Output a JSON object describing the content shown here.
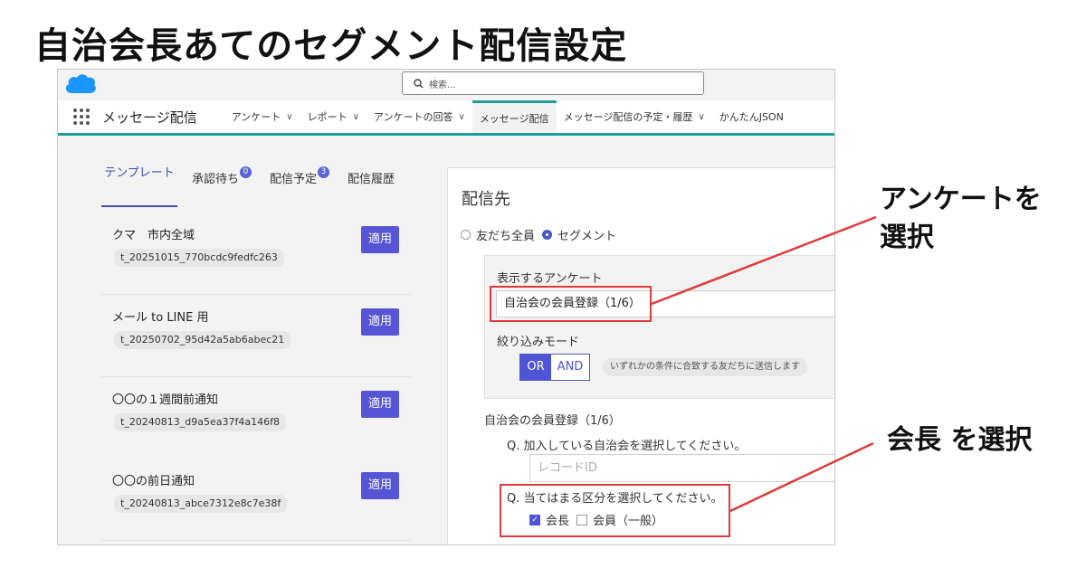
{
  "headline": "自治会長あてのセグメント配信設定",
  "search": {
    "placeholder": "検索..."
  },
  "nav": {
    "app_name": "メッセージ配信",
    "items": [
      {
        "label": "アンケート",
        "has_menu": true
      },
      {
        "label": "レポート",
        "has_menu": true
      },
      {
        "label": "アンケートの回答",
        "has_menu": true
      },
      {
        "label": "メッセージ配信",
        "has_menu": false,
        "active": true
      },
      {
        "label": "メッセージ配信の予定・履歴",
        "has_menu": true
      },
      {
        "label": "かんたんJSON",
        "has_menu": false
      }
    ]
  },
  "tabs": {
    "template": "テンプレート",
    "approval": "承認待ち",
    "approval_count": "0",
    "scheduled": "配信予定",
    "scheduled_count": "3",
    "history": "配信履歴"
  },
  "templates": [
    {
      "name": "クマ　市内全域",
      "id": "t_20251015_770bcdc9fedfc263",
      "button": "適用"
    },
    {
      "name": "メール to LINE 用",
      "id": "t_20250702_95d42a5ab6abec21",
      "button": "適用"
    },
    {
      "name": "〇〇の１週間前通知",
      "id": "t_20240813_d9a5ea37f4a146f8",
      "button": "適用"
    },
    {
      "name": "〇〇の前日通知",
      "id": "t_20240813_abce7312e8c7e38f",
      "button": "適用"
    }
  ],
  "destination": {
    "title": "配信先",
    "option_all": "友だち全員",
    "option_segment": "セグメント",
    "selected": "segment",
    "survey_label": "表示するアンケート",
    "survey_value": "自治会の会員登録（1/6）",
    "mode_label": "絞り込みモード",
    "mode_or": "OR",
    "mode_and": "AND",
    "mode_selected": "OR",
    "mode_help": "いずれかの条件に合致する友だちに送信します",
    "survey_name": "自治会の会員登録（1/6）",
    "q1": "Q. 加入している自治会を選択してください。",
    "q1_placeholder": "レコードID",
    "q2": "Q. 当てはまる区分を選択してください。",
    "q2_options": [
      {
        "label": "会長",
        "checked": true
      },
      {
        "label": "会員（一般）",
        "checked": false
      }
    ]
  },
  "callouts": {
    "survey": [
      "アンケートを",
      "選択"
    ],
    "president": "会長 を選択"
  },
  "colors": {
    "accent": "#4f55d4",
    "nav_line": "#1f9e9a",
    "highlight": "#e03a3a",
    "salesforce_blue": "#1b96ff"
  }
}
